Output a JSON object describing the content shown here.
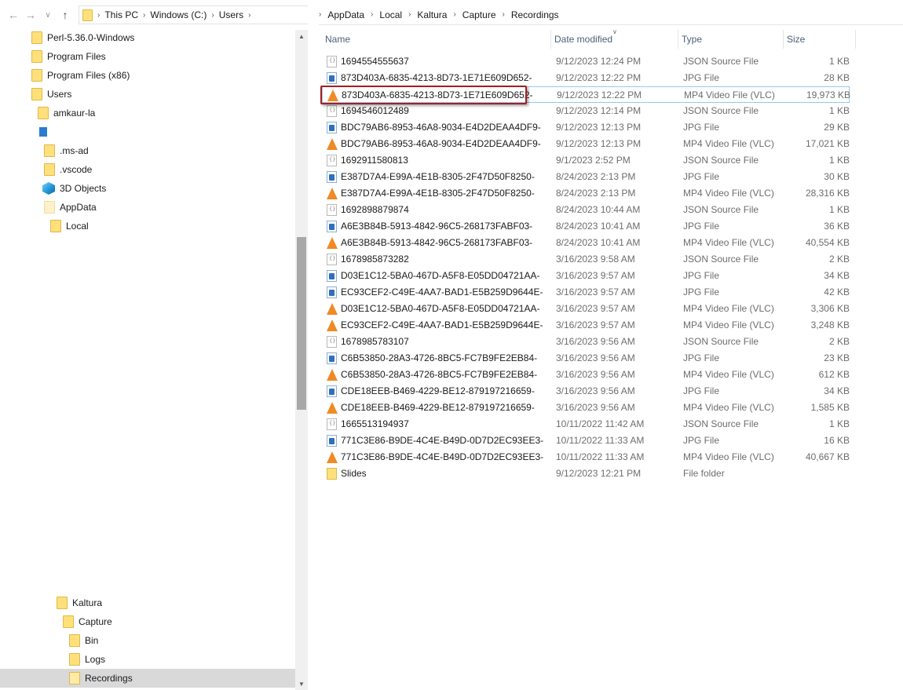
{
  "left_breadcrumb": [
    "This PC",
    "Windows (C:)",
    "Users"
  ],
  "right_breadcrumb": [
    "AppData",
    "Local",
    "Kaltura",
    "Capture",
    "Recordings"
  ],
  "tree": [
    {
      "label": "Perl-5.36.0-Windows",
      "icon": "folder"
    },
    {
      "label": "Program Files",
      "icon": "folder"
    },
    {
      "label": "Program Files (x86)",
      "icon": "folder"
    },
    {
      "label": "Users",
      "icon": "folder"
    },
    {
      "label": "amkaur-la",
      "icon": "folder"
    },
    {
      "label": "",
      "icon": "building"
    },
    {
      "label": ".ms-ad",
      "icon": "folder"
    },
    {
      "label": ".vscode",
      "icon": "folder"
    },
    {
      "label": "3D Objects",
      "icon": "cube"
    },
    {
      "label": "AppData",
      "icon": "folder-light"
    },
    {
      "label": "Local",
      "icon": "folder"
    },
    {
      "label": "Kaltura",
      "icon": "folder"
    },
    {
      "label": "Capture",
      "icon": "folder"
    },
    {
      "label": "Bin",
      "icon": "folder"
    },
    {
      "label": "Logs",
      "icon": "folder"
    },
    {
      "label": "Recordings",
      "icon": "folder"
    }
  ],
  "columns": {
    "name": "Name",
    "date": "Date modified",
    "type": "Type",
    "size": "Size"
  },
  "files": [
    {
      "name": "1694554555637",
      "date": "9/12/2023 12:24 PM",
      "type": "JSON Source File",
      "size": "1 KB",
      "icon": "json"
    },
    {
      "name": "873D403A-6835-4213-8D73-1E71E609D652-",
      "date": "9/12/2023 12:22 PM",
      "type": "JPG File",
      "size": "28 KB",
      "icon": "jpg"
    },
    {
      "name": "873D403A-6835-4213-8D73-1E71E609D652-",
      "date": "9/12/2023 12:22 PM",
      "type": "MP4 Video File (VLC)",
      "size": "19,973 KB",
      "icon": "vlc"
    },
    {
      "name": "1694546012489",
      "date": "9/12/2023 12:14 PM",
      "type": "JSON Source File",
      "size": "1 KB",
      "icon": "json"
    },
    {
      "name": "BDC79AB6-8953-46A8-9034-E4D2DEAA4DF9-",
      "date": "9/12/2023 12:13 PM",
      "type": "JPG File",
      "size": "29 KB",
      "icon": "jpg"
    },
    {
      "name": "BDC79AB6-8953-46A8-9034-E4D2DEAA4DF9-",
      "date": "9/12/2023 12:13 PM",
      "type": "MP4 Video File (VLC)",
      "size": "17,021 KB",
      "icon": "vlc"
    },
    {
      "name": "1692911580813",
      "date": "9/1/2023 2:52 PM",
      "type": "JSON Source File",
      "size": "1 KB",
      "icon": "json"
    },
    {
      "name": "E387D7A4-E99A-4E1B-8305-2F47D50F8250-",
      "date": "8/24/2023 2:13 PM",
      "type": "JPG File",
      "size": "30 KB",
      "icon": "jpg"
    },
    {
      "name": "E387D7A4-E99A-4E1B-8305-2F47D50F8250-",
      "date": "8/24/2023 2:13 PM",
      "type": "MP4 Video File (VLC)",
      "size": "28,316 KB",
      "icon": "vlc"
    },
    {
      "name": "1692898879874",
      "date": "8/24/2023 10:44 AM",
      "type": "JSON Source File",
      "size": "1 KB",
      "icon": "json"
    },
    {
      "name": "A6E3B84B-5913-4842-96C5-268173FABF03-",
      "date": "8/24/2023 10:41 AM",
      "type": "JPG File",
      "size": "36 KB",
      "icon": "jpg"
    },
    {
      "name": "A6E3B84B-5913-4842-96C5-268173FABF03-",
      "date": "8/24/2023 10:41 AM",
      "type": "MP4 Video File (VLC)",
      "size": "40,554 KB",
      "icon": "vlc"
    },
    {
      "name": "1678985873282",
      "date": "3/16/2023 9:58 AM",
      "type": "JSON Source File",
      "size": "2 KB",
      "icon": "json"
    },
    {
      "name": "D03E1C12-5BA0-467D-A5F8-E05DD04721AA-",
      "date": "3/16/2023 9:57 AM",
      "type": "JPG File",
      "size": "34 KB",
      "icon": "jpg"
    },
    {
      "name": "EC93CEF2-C49E-4AA7-BAD1-E5B259D9644E-",
      "date": "3/16/2023 9:57 AM",
      "type": "JPG File",
      "size": "42 KB",
      "icon": "jpg"
    },
    {
      "name": "D03E1C12-5BA0-467D-A5F8-E05DD04721AA-",
      "date": "3/16/2023 9:57 AM",
      "type": "MP4 Video File (VLC)",
      "size": "3,306 KB",
      "icon": "vlc"
    },
    {
      "name": "EC93CEF2-C49E-4AA7-BAD1-E5B259D9644E-",
      "date": "3/16/2023 9:57 AM",
      "type": "MP4 Video File (VLC)",
      "size": "3,248 KB",
      "icon": "vlc"
    },
    {
      "name": "1678985783107",
      "date": "3/16/2023 9:56 AM",
      "type": "JSON Source File",
      "size": "2 KB",
      "icon": "json"
    },
    {
      "name": "C6B53850-28A3-4726-8BC5-FC7B9FE2EB84-",
      "date": "3/16/2023 9:56 AM",
      "type": "JPG File",
      "size": "23 KB",
      "icon": "jpg"
    },
    {
      "name": "C6B53850-28A3-4726-8BC5-FC7B9FE2EB84-",
      "date": "3/16/2023 9:56 AM",
      "type": "MP4 Video File (VLC)",
      "size": "612 KB",
      "icon": "vlc"
    },
    {
      "name": "CDE18EEB-B469-4229-BE12-879197216659-",
      "date": "3/16/2023 9:56 AM",
      "type": "JPG File",
      "size": "34 KB",
      "icon": "jpg"
    },
    {
      "name": "CDE18EEB-B469-4229-BE12-879197216659-",
      "date": "3/16/2023 9:56 AM",
      "type": "MP4 Video File (VLC)",
      "size": "1,585 KB",
      "icon": "vlc"
    },
    {
      "name": "1665513194937",
      "date": "10/11/2022 11:42 AM",
      "type": "JSON Source File",
      "size": "1 KB",
      "icon": "json"
    },
    {
      "name": "771C3E86-B9DE-4C4E-B49D-0D7D2EC93EE3-",
      "date": "10/11/2022 11:33 AM",
      "type": "JPG File",
      "size": "16 KB",
      "icon": "jpg"
    },
    {
      "name": "771C3E86-B9DE-4C4E-B49D-0D7D2EC93EE3-",
      "date": "10/11/2022 11:33 AM",
      "type": "MP4 Video File (VLC)",
      "size": "40,667 KB",
      "icon": "vlc"
    },
    {
      "name": "Slides",
      "date": "9/12/2023 12:21 PM",
      "type": "File folder",
      "size": "",
      "icon": "folder"
    }
  ],
  "colors": {
    "accent_red": "#a61e22",
    "selection_border": "#9bc6e8",
    "vlc_orange": "#f08a24"
  }
}
